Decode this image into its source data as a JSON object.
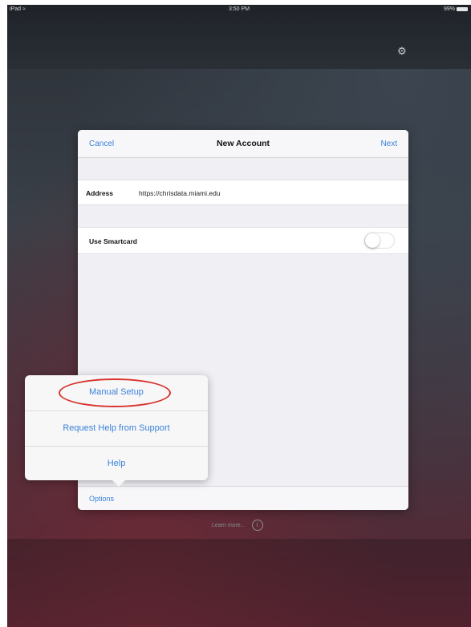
{
  "status_bar": {
    "device": "iPad",
    "time": "3:50 PM",
    "battery": "99%"
  },
  "dialog": {
    "title": "New Account",
    "cancel_label": "Cancel",
    "next_label": "Next",
    "address_label": "Address",
    "address_value": "https://chrisdata.miami.edu",
    "smartcard_label": "Use Smartcard",
    "smartcard_enabled": false,
    "options_label": "Options"
  },
  "options_menu": {
    "items": [
      {
        "label": "Manual Setup",
        "highlighted": true
      },
      {
        "label": "Request Help from Support"
      },
      {
        "label": "Help"
      }
    ]
  },
  "footer": {
    "learn_more": "Learn more..."
  },
  "icons": {
    "wifi": "wifi-icon",
    "battery": "battery-icon",
    "settings": "gear-icon",
    "info": "info-icon"
  },
  "colors": {
    "accent": "#3b82d8",
    "highlight_ring": "#d9342f"
  }
}
